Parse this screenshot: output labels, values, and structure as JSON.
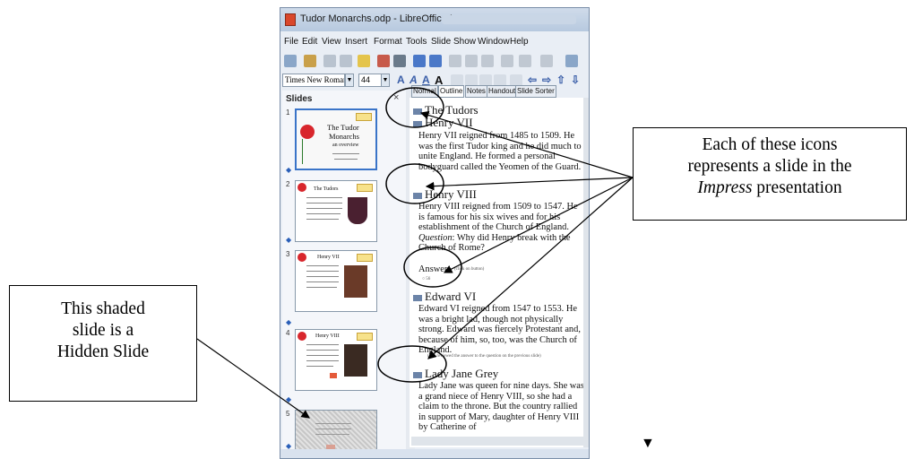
{
  "window": {
    "title": "Tudor Monarchs.odp - LibreOffice Impress"
  },
  "menubar": [
    "File",
    "Edit",
    "View",
    "Insert",
    "Format",
    "Tools",
    "Slide Show",
    "Window",
    "Help"
  ],
  "toolbar": {
    "font_name": "Times New Roman",
    "font_size": "44"
  },
  "slides_pane": {
    "header": "Slides",
    "close": "×",
    "slides": [
      {
        "number": "1",
        "title": "The Tudor",
        "title2": "Monarchs",
        "subtitle": "an overview"
      },
      {
        "number": "2",
        "title": "The Tudors"
      },
      {
        "number": "3",
        "title": "Henry VII"
      },
      {
        "number": "4",
        "title": "Henry VIII"
      },
      {
        "number": "5",
        "title": ""
      }
    ]
  },
  "tabs": [
    "Normal",
    "Outline",
    "Notes",
    "Handout",
    "Slide Sorter"
  ],
  "outline": {
    "headings": [
      "The Tudors",
      "Henry VII",
      "Henry VIII",
      "Edward VI",
      "Lady Jane Grey"
    ],
    "henry7_text": "Henry VII reigned from 1485 to 1509. He was the first Tudor king and he did much to unite England. He formed a personal bodyguard called the Yeomen of the Guard.",
    "henry8_text": "Henry VIII reigned from 1509 to 1547. He is famous for his six wives and for his establishment of the Church of England.",
    "henry8_question_label": "Question",
    "henry8_question": ": Why did Henry break with the Church of Rome?",
    "henry8_answer": "Answer",
    "henry8_answer_small": "(click on button)",
    "edward_text": "Edward VI reigned from 1547 to 1553. He was a bright lad, though not physically strong. Edward was fiercely Protestant and, because of him, so, too, was the Church of England.",
    "edward_small": "(you reviewed the answer to the question on the previous slide)",
    "jane_text": "Lady Jane was queen for nine days. She was a grand niece of Henry VIII, so she had a claim to the throne. But the country rallied in support of Mary, daughter of Henry VIII by Catherine of"
  },
  "callouts": {
    "right_line1": "Each of these icons",
    "right_line2": "represents a slide in the",
    "right_italic": "Impress",
    "right_line3_rest": " presentation",
    "left_line1": "This shaded",
    "left_line2": "slide is a",
    "left_line3": "Hidden Slide"
  }
}
